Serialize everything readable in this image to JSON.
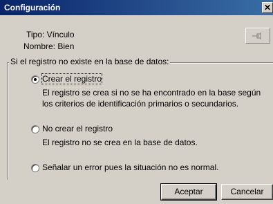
{
  "window": {
    "title": "Configuración",
    "close_symbol": "✕"
  },
  "info": {
    "tipo_label": "Tipo: Vínculo",
    "nombre_label": "Nombre: Bien",
    "pin_icon": "pin-icon"
  },
  "group": {
    "legend": "Si el registro no existe en la base de datos:",
    "options": [
      {
        "label": "Crear el registro",
        "selected": true,
        "description_line1": "El registro se crea si no se ha encontrado en la base según",
        "description_line2": "los criterios de identificación primarios o secundarios."
      },
      {
        "label": "No crear el registro",
        "selected": false,
        "description_line1": "El registro no se crea en la base de datos."
      },
      {
        "label": "Señalar un error pues la situación no es normal.",
        "selected": false
      }
    ]
  },
  "buttons": {
    "ok": "Aceptar",
    "cancel": "Cancelar"
  }
}
